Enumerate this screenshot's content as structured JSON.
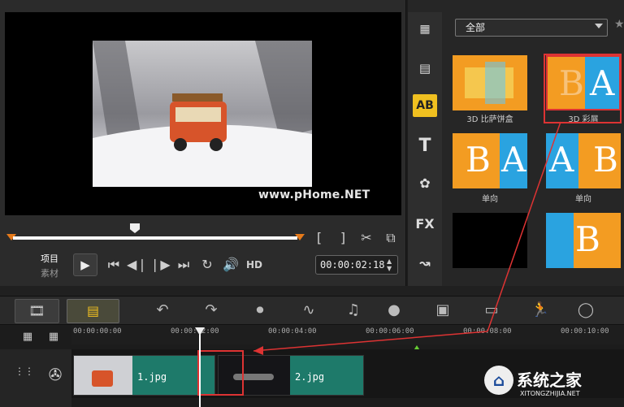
{
  "preview": {
    "watermark": "www.pHome.NET",
    "mode_project": "项目",
    "mode_clip": "素材",
    "timecode": "00:00:02:18",
    "hd_label": "HD",
    "bracket_in": "[",
    "bracket_out": "]"
  },
  "library": {
    "category_select": "全部",
    "sidebar_icons": [
      "media-icon",
      "instant-project-icon",
      "transition-icon",
      "title-icon",
      "graphic-icon",
      "filter-icon",
      "path-icon"
    ],
    "fx_label": "FX",
    "transitions": [
      {
        "label": "3D 比萨饼盒"
      },
      {
        "label": "3D 彩屑"
      },
      {
        "label": "单向"
      },
      {
        "label": "单向"
      },
      {
        "label": ""
      },
      {
        "label": ""
      }
    ]
  },
  "timeline": {
    "ruler_ticks": [
      "00:00:00:00",
      "00:00:02:00",
      "00:00:04:00",
      "00:00:06:00",
      "00:00:08:00",
      "00:00:10:00"
    ],
    "clips": [
      {
        "label": "1.jpg"
      },
      {
        "label": "2.jpg"
      }
    ]
  },
  "watermark_site": {
    "brand": "系统之家",
    "url": "XITONGZHIJIA.NET"
  }
}
